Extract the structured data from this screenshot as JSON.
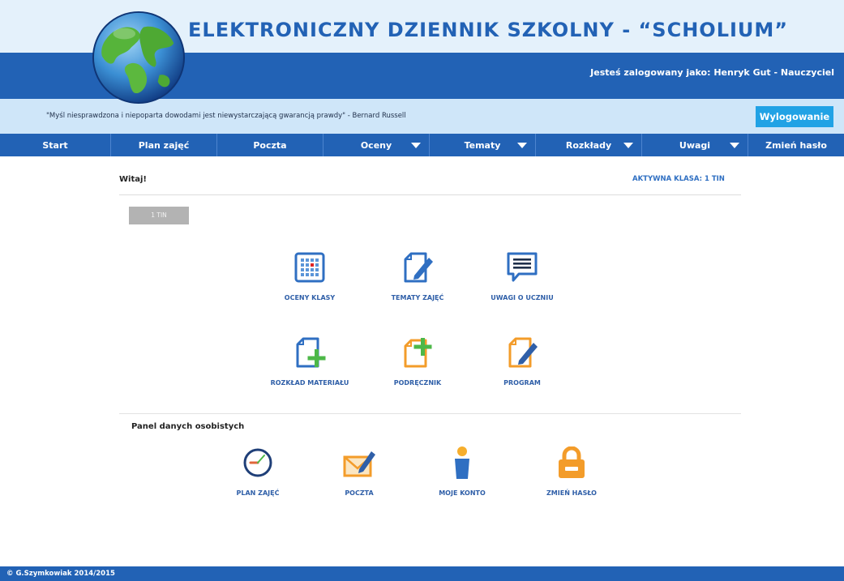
{
  "header": {
    "title": "ELEKTRONICZNY DZIENNIK SZKOLNY - “SCHOLIUM”",
    "user_info": "Jesteś zalogowany jako: Henryk Gut - Nauczyciel"
  },
  "quote_bar": {
    "quote": "\"Myśl niesprawdzona i niepoparta dowodami jest niewystarczającą gwarancją prawdy\" - Bernard Russell",
    "logout_label": "Wylogowanie"
  },
  "nav": {
    "items": [
      {
        "label": "Start",
        "dropdown": false
      },
      {
        "label": "Plan zajęć",
        "dropdown": false
      },
      {
        "label": "Poczta",
        "dropdown": false
      },
      {
        "label": "Oceny",
        "dropdown": true
      },
      {
        "label": "Tematy",
        "dropdown": true
      },
      {
        "label": "Rozkłady",
        "dropdown": true
      },
      {
        "label": "Uwagi",
        "dropdown": true
      },
      {
        "label": "Zmień hasło",
        "dropdown": false
      }
    ]
  },
  "main": {
    "welcome": "Witaj!",
    "active_class": "AKTYWNA KLASA: 1 TIN",
    "class_button": "1 TIN",
    "tiles": [
      {
        "label": "OCENY KLASY",
        "icon": "grades-grid-icon"
      },
      {
        "label": "TEMATY ZAJĘĆ",
        "icon": "edit-document-icon"
      },
      {
        "label": "UWAGI O UCZNIU",
        "icon": "comment-icon"
      },
      {
        "label": "ROZKŁAD MATERIAŁU",
        "icon": "add-document-icon"
      },
      {
        "label": "PODRĘCZNIK",
        "icon": "add-document-orange-icon"
      },
      {
        "label": "PROGRAM",
        "icon": "edit-document-orange-icon"
      }
    ]
  },
  "personal_panel": {
    "title": "Panel danych osobistych",
    "tiles": [
      {
        "label": "PLAN ZAJĘĆ",
        "icon": "clock-icon"
      },
      {
        "label": "POCZTA",
        "icon": "envelope-pen-icon"
      },
      {
        "label": "MOJE KONTO",
        "icon": "user-icon"
      },
      {
        "label": "ZMIEŃ HASŁO",
        "icon": "lock-icon"
      }
    ]
  },
  "footer": {
    "copyright": "© G.Szymkowiak 2014/2015"
  },
  "colors": {
    "brand_blue": "#2262b5",
    "header_light": "#e4f1fb",
    "quote_bar": "#cfe6f9",
    "logout_button": "#21a2e5",
    "tile_blue": "#2f6fc2",
    "accent_orange": "#f39c2a",
    "accent_green": "#4db848"
  }
}
